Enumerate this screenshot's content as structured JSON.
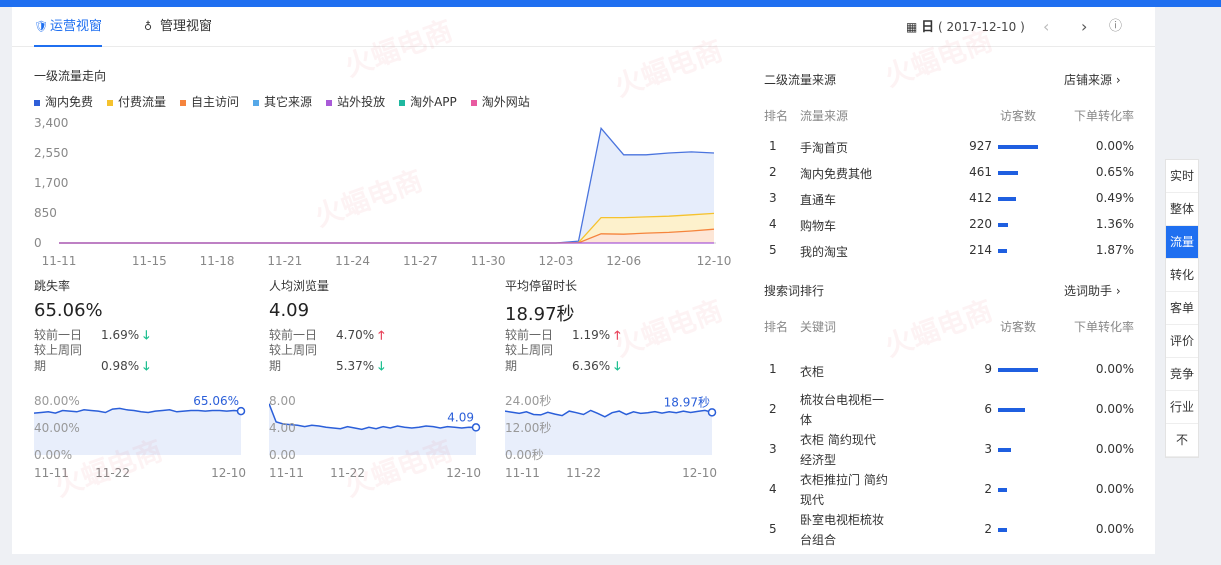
{
  "tabs": [
    {
      "label": "运营视窗",
      "icon": "shield-icon"
    },
    {
      "label": "管理视窗",
      "icon": "medal-icon"
    }
  ],
  "date": {
    "prefix": "日",
    "value": "( 2017-12-10 )"
  },
  "traffic_trend": {
    "title": "一级流量走向",
    "legend": [
      {
        "name": "淘内免费",
        "color": "#2f5fd8"
      },
      {
        "name": "付费流量",
        "color": "#f5c22e"
      },
      {
        "name": "自主访问",
        "color": "#f5843d"
      },
      {
        "name": "其它来源",
        "color": "#56a8e8"
      },
      {
        "name": "站外投放",
        "color": "#a95ad8"
      },
      {
        "name": "淘外APP",
        "color": "#1fb8a0"
      },
      {
        "name": "淘外网站",
        "color": "#e85aa0"
      }
    ]
  },
  "chart_data": [
    {
      "type": "area",
      "title": "一级流量走向",
      "x": [
        "11-11",
        "11-12",
        "11-13",
        "11-14",
        "11-15",
        "11-16",
        "11-17",
        "11-18",
        "11-19",
        "11-20",
        "11-21",
        "11-22",
        "11-23",
        "11-24",
        "11-25",
        "11-26",
        "11-27",
        "11-28",
        "11-29",
        "11-30",
        "12-01",
        "12-02",
        "12-03",
        "12-04",
        "12-05",
        "12-06",
        "12-07",
        "12-08",
        "12-09",
        "12-10"
      ],
      "xticks": [
        "11-11",
        "11-15",
        "11-18",
        "11-21",
        "11-24",
        "11-27",
        "11-30",
        "12-03",
        "12-06",
        "12-10"
      ],
      "yticks": [
        "0",
        "850",
        "1,700",
        "2,550",
        "3,400"
      ],
      "ylim": [
        0,
        3400
      ],
      "series": [
        {
          "name": "淘内免费",
          "values": [
            0,
            0,
            0,
            0,
            0,
            0,
            0,
            0,
            0,
            0,
            0,
            0,
            0,
            0,
            0,
            0,
            0,
            0,
            0,
            0,
            0,
            0,
            0,
            50,
            3250,
            2500,
            2500,
            2550,
            2580,
            2550
          ]
        },
        {
          "name": "付费流量",
          "values": [
            0,
            0,
            0,
            0,
            0,
            0,
            0,
            0,
            0,
            0,
            0,
            0,
            0,
            0,
            0,
            0,
            0,
            0,
            0,
            0,
            0,
            0,
            0,
            10,
            720,
            720,
            740,
            760,
            800,
            840
          ]
        },
        {
          "name": "自主访问",
          "values": [
            0,
            0,
            0,
            0,
            0,
            0,
            0,
            0,
            0,
            0,
            0,
            0,
            0,
            0,
            0,
            0,
            0,
            0,
            0,
            0,
            0,
            0,
            0,
            5,
            260,
            250,
            280,
            300,
            340,
            390
          ]
        }
      ]
    },
    {
      "type": "area",
      "title": "跳失率",
      "x": [
        "11-11",
        "11-12",
        "11-13",
        "11-14",
        "11-15",
        "11-16",
        "11-17",
        "11-18",
        "11-19",
        "11-20",
        "11-21",
        "11-22",
        "11-23",
        "11-24",
        "11-25",
        "11-26",
        "11-27",
        "11-28",
        "11-29",
        "11-30",
        "12-01",
        "12-02",
        "12-03",
        "12-04",
        "12-05",
        "12-06",
        "12-07",
        "12-08",
        "12-09",
        "12-10"
      ],
      "xticks": [
        "11-11",
        "11-22",
        "12-10"
      ],
      "yticks": [
        "0.00%",
        "40.00%",
        "80.00%"
      ],
      "ylim": [
        0,
        80
      ],
      "series": [
        {
          "name": "跳失率",
          "values": [
            62,
            63,
            64,
            62,
            66,
            65,
            64,
            67,
            66,
            65,
            63,
            68,
            69,
            67,
            66,
            64,
            63,
            65,
            66,
            67,
            64,
            65,
            66,
            66,
            65,
            66,
            66,
            65,
            66,
            65.06
          ]
        }
      ]
    },
    {
      "type": "area",
      "title": "人均浏览量",
      "x": [
        "11-11",
        "11-12",
        "11-13",
        "11-14",
        "11-15",
        "11-16",
        "11-17",
        "11-18",
        "11-19",
        "11-20",
        "11-21",
        "11-22",
        "11-23",
        "11-24",
        "11-25",
        "11-26",
        "11-27",
        "11-28",
        "11-29",
        "11-30",
        "12-01",
        "12-02",
        "12-03",
        "12-04",
        "12-05",
        "12-06",
        "12-07",
        "12-08",
        "12-09",
        "12-10"
      ],
      "xticks": [
        "11-11",
        "11-22",
        "12-10"
      ],
      "yticks": [
        "0.00",
        "4.00",
        "8.00"
      ],
      "ylim": [
        0,
        8
      ],
      "series": [
        {
          "name": "人均浏览量",
          "values": [
            7.6,
            4.9,
            4.6,
            4.5,
            4.4,
            4.2,
            4.4,
            4.3,
            4.1,
            4.0,
            3.9,
            4.2,
            4.0,
            3.8,
            4.1,
            3.9,
            4.2,
            4.0,
            4.3,
            4.1,
            4.0,
            4.1,
            4.3,
            4.2,
            4.0,
            4.2,
            4.1,
            4.0,
            4.1,
            4.09
          ]
        }
      ]
    },
    {
      "type": "area",
      "title": "平均停留时长",
      "x": [
        "11-11",
        "11-12",
        "11-13",
        "11-14",
        "11-15",
        "11-16",
        "11-17",
        "11-18",
        "11-19",
        "11-20",
        "11-21",
        "11-22",
        "11-23",
        "11-24",
        "11-25",
        "11-26",
        "11-27",
        "11-28",
        "11-29",
        "11-30",
        "12-01",
        "12-02",
        "12-03",
        "12-04",
        "12-05",
        "12-06",
        "12-07",
        "12-08",
        "12-09",
        "12-10"
      ],
      "xticks": [
        "11-11",
        "11-22",
        "12-10"
      ],
      "yticks": [
        "0.00秒",
        "12.00秒",
        "24.00秒"
      ],
      "ylim": [
        0,
        24
      ],
      "series": [
        {
          "name": "平均停留时长",
          "values": [
            19.5,
            19.0,
            18.5,
            19.2,
            18.0,
            17.8,
            19.0,
            18.2,
            17.5,
            19.5,
            18.8,
            18.0,
            19.8,
            18.5,
            17.0,
            18.8,
            19.5,
            18.0,
            19.2,
            18.5,
            18.8,
            19.3,
            18.6,
            19.2,
            18.8,
            19.5,
            18.9,
            19.4,
            19.8,
            18.97
          ]
        }
      ]
    }
  ],
  "metrics": [
    {
      "name": "跳失率",
      "value": "65.06%",
      "day_label": "较前一日",
      "day_pct": "1.69%",
      "day_dir": "down",
      "week_label1": "较上周同",
      "week_label2": "期",
      "week_pct": "0.98%",
      "week_dir": "down",
      "last_label": "65.06%"
    },
    {
      "name": "人均浏览量",
      "value": "4.09",
      "day_label": "较前一日",
      "day_pct": "4.70%",
      "day_dir": "up",
      "week_label1": "较上周同",
      "week_label2": "期",
      "week_pct": "5.37%",
      "week_dir": "down",
      "last_label": "4.09"
    },
    {
      "name": "平均停留时长",
      "value": "18.97秒",
      "day_label": "较前一日",
      "day_pct": "1.19%",
      "day_dir": "up",
      "week_label1": "较上周同",
      "week_label2": "期",
      "week_pct": "6.36%",
      "week_dir": "down",
      "last_label": "18.97秒"
    }
  ],
  "secondary_sources": {
    "title": "二级流量来源",
    "link": "店铺来源",
    "headers": {
      "rank": "排名",
      "name": "流量来源",
      "visitors": "访客数",
      "conv": "下单转化率"
    },
    "rows": [
      {
        "rank": "1",
        "name": "手淘首页",
        "visitors": "927",
        "bar": 1.0,
        "conv": "0.00%"
      },
      {
        "rank": "2",
        "name": "淘内免费其他",
        "visitors": "461",
        "bar": 0.5,
        "conv": "0.65%"
      },
      {
        "rank": "3",
        "name": "直通车",
        "visitors": "412",
        "bar": 0.44,
        "conv": "0.49%"
      },
      {
        "rank": "4",
        "name": "购物车",
        "visitors": "220",
        "bar": 0.24,
        "conv": "1.36%"
      },
      {
        "rank": "5",
        "name": "我的淘宝",
        "visitors": "214",
        "bar": 0.23,
        "conv": "1.87%"
      }
    ]
  },
  "keywords": {
    "title": "搜索词排行",
    "link": "选词助手",
    "headers": {
      "rank": "排名",
      "name": "关键词",
      "visitors": "访客数",
      "conv": "下单转化率"
    },
    "rows": [
      {
        "rank": "1",
        "line1": "衣柜",
        "line2": "",
        "visitors": "9",
        "bar": 1.0,
        "conv": "0.00%"
      },
      {
        "rank": "2",
        "line1": "梳妆台电视柜一",
        "line2": "体",
        "visitors": "6",
        "bar": 0.67,
        "conv": "0.00%"
      },
      {
        "rank": "3",
        "line1": "衣柜 简约现代",
        "line2": "经济型",
        "visitors": "3",
        "bar": 0.33,
        "conv": "0.00%"
      },
      {
        "rank": "4",
        "line1": "衣柜推拉门 简约",
        "line2": "现代",
        "visitors": "2",
        "bar": 0.22,
        "conv": "0.00%"
      },
      {
        "rank": "5",
        "line1": "卧室电视柜梳妆",
        "line2": "台组合",
        "visitors": "2",
        "bar": 0.22,
        "conv": "0.00%"
      }
    ]
  },
  "right_nav": [
    {
      "label": "实时",
      "active": false
    },
    {
      "label": "整体",
      "active": false
    },
    {
      "label": "流量",
      "active": true
    },
    {
      "label": "转化",
      "active": false
    },
    {
      "label": "客单",
      "active": false
    },
    {
      "label": "评价",
      "active": false
    },
    {
      "label": "竞争",
      "active": false
    },
    {
      "label": "行业",
      "active": false
    },
    {
      "label": "不",
      "active": false
    }
  ],
  "watermark": "火蝠电商",
  "colors": {
    "accent": "#1f6ff0",
    "up": "#e8455c",
    "down": "#1bbf8f",
    "bar": "#1f5fe0"
  }
}
